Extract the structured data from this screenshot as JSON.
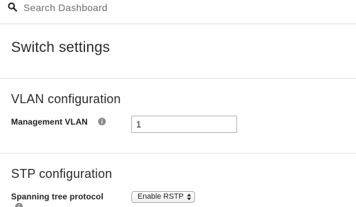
{
  "search": {
    "placeholder": "Search Dashboard",
    "icon": "search-icon"
  },
  "page": {
    "title": "Switch settings"
  },
  "vlan_section": {
    "heading": "VLAN configuration",
    "management_vlan": {
      "label": "Management VLAN",
      "value": "1",
      "icon": "info-icon"
    }
  },
  "stp_section": {
    "heading": "STP configuration",
    "spanning_tree": {
      "label": "Spanning tree protocol",
      "selected": "Enable RSTP",
      "icon": "info-icon"
    }
  },
  "colors": {
    "text": "#222222",
    "divider": "#e0e0e0",
    "input_border": "#b3b3b3",
    "icon_gray": "#8a8a8a"
  }
}
